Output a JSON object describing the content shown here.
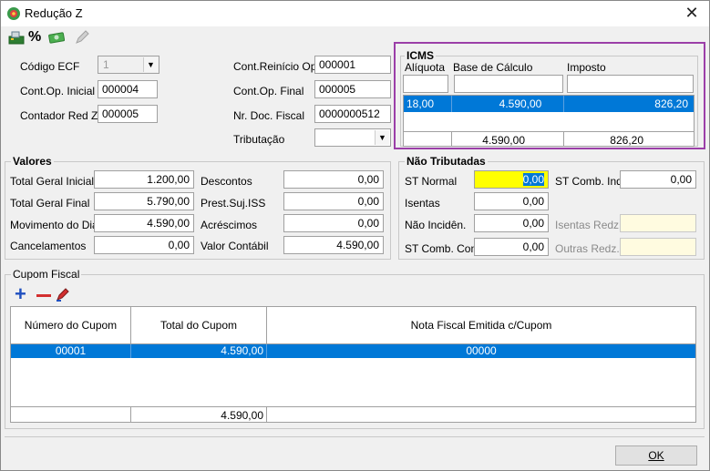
{
  "window": {
    "title": "Redução Z"
  },
  "toolbar": {
    "icons": [
      "cash-register-icon",
      "percent-icon",
      "money-icon",
      "edit-icon"
    ]
  },
  "header_fields": {
    "codigo_ecf": {
      "label": "Código ECF",
      "value": "1"
    },
    "cont_op_inicial": {
      "label": "Cont.Op. Inicial",
      "value": "000004"
    },
    "contador_red_z": {
      "label": "Contador Red Z",
      "value": "000005"
    },
    "cont_reinicio_op": {
      "label": "Cont.Reinício Op.",
      "value": "000001"
    },
    "cont_op_final": {
      "label": "Cont.Op. Final",
      "value": "000005"
    },
    "nr_doc_fiscal": {
      "label": "Nr. Doc. Fiscal",
      "value": "0000000512"
    },
    "tributacao": {
      "label": "Tributação",
      "value": ""
    }
  },
  "icms": {
    "title": "ICMS",
    "headers": {
      "aliquota": "Alíquota",
      "base": "Base de Cálculo",
      "imposto": "Imposto"
    },
    "row": {
      "aliquota": "18,00",
      "base": "4.590,00",
      "imposto": "826,20"
    },
    "totals": {
      "base": "4.590,00",
      "imposto": "826,20"
    }
  },
  "valores": {
    "title": "Valores",
    "total_geral_inicial": {
      "label": "Total Geral Inicial",
      "value": "1.200,00"
    },
    "total_geral_final": {
      "label": "Total Geral Final",
      "value": "5.790,00"
    },
    "movimento_dia": {
      "label": "Movimento do Dia",
      "value": "4.590,00"
    },
    "cancelamentos": {
      "label": "Cancelamentos",
      "value": "0,00"
    },
    "descontos": {
      "label": "Descontos",
      "value": "0,00"
    },
    "prest_suj_iss": {
      "label": "Prest.Suj.ISS",
      "value": "0,00"
    },
    "acrescimos": {
      "label": "Acréscimos",
      "value": "0,00"
    },
    "valor_contabil": {
      "label": "Valor Contábil",
      "value": "4.590,00"
    }
  },
  "nao_tributadas": {
    "title": "Não Tributadas",
    "st_normal": {
      "label": "ST Normal",
      "value": "0,00"
    },
    "isentas": {
      "label": "Isentas",
      "value": "0,00"
    },
    "nao_incidencia": {
      "label": "Não Incidên.",
      "value": "0,00"
    },
    "st_comb_cons": {
      "label": "ST Comb. Cons",
      "value": "0,00"
    },
    "st_comb_ind": {
      "label": "ST Comb. Ind.",
      "value": "0,00"
    },
    "isentas_redz": {
      "label": "Isentas Redz.",
      "value": ""
    },
    "outras_redz": {
      "label": "Outras Redz.",
      "value": ""
    }
  },
  "cupom": {
    "title": "Cupom Fiscal",
    "headers": {
      "numero": "Número do Cupom",
      "total": "Total do Cupom",
      "nota": "Nota Fiscal Emitida c/Cupom"
    },
    "row": {
      "numero": "00001",
      "total": "4.590,00",
      "nota": "00000"
    },
    "footer_total": "4.590,00"
  },
  "buttons": {
    "ok": "OK"
  },
  "colors": {
    "selection": "#0078d7",
    "highlight": "#9b3fa8",
    "focus": "#ffff00"
  }
}
